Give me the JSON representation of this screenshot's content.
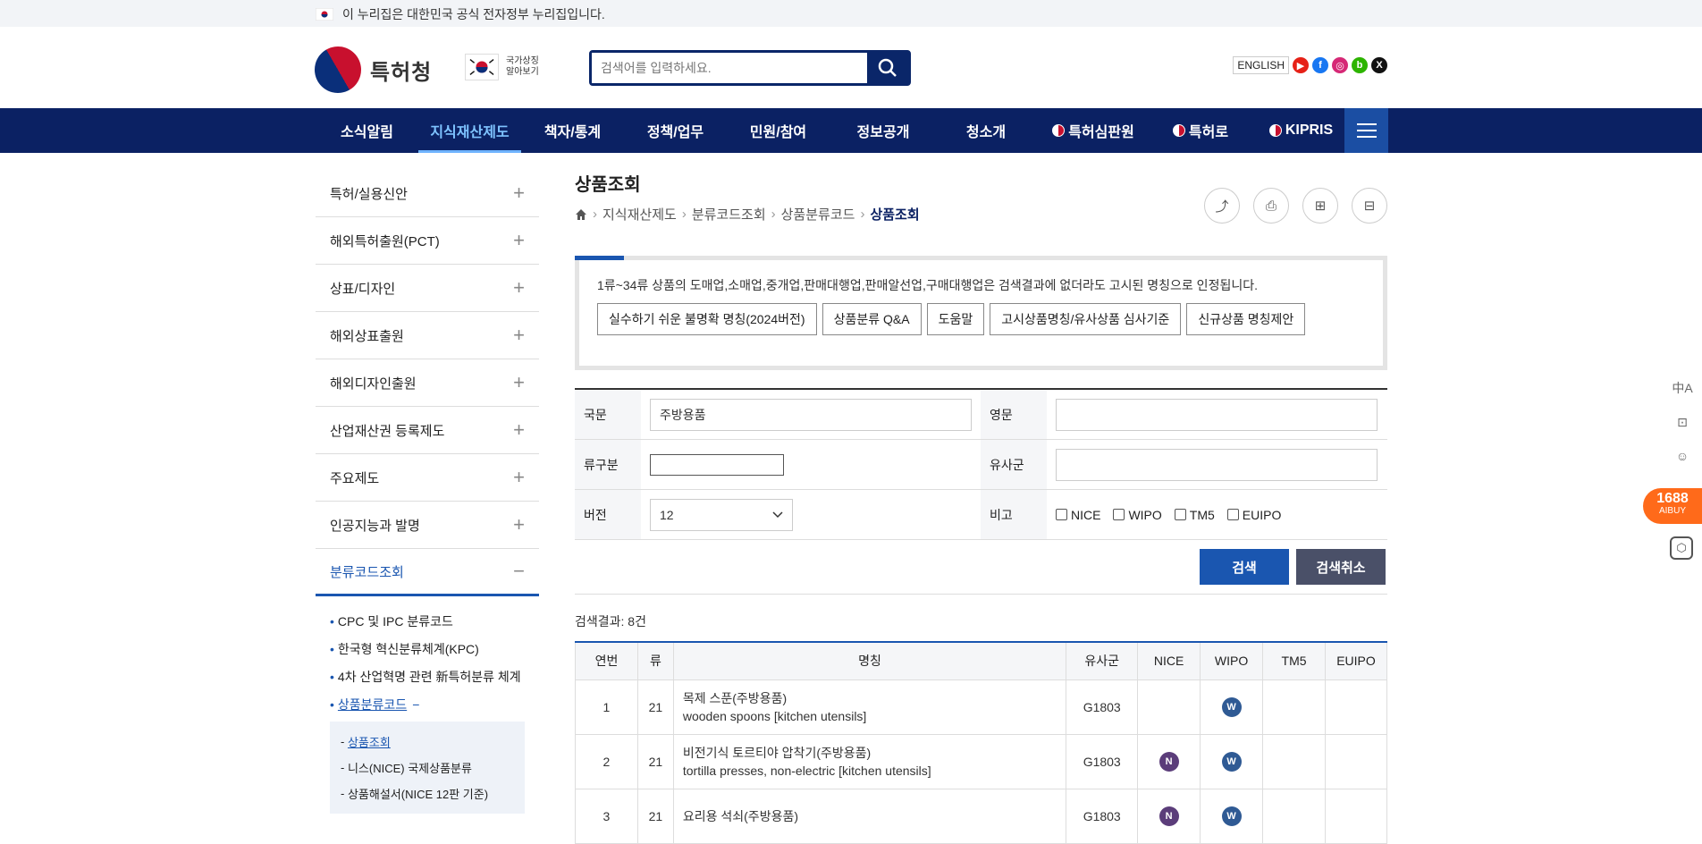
{
  "topbar": {
    "text": "이 누리집은 대한민국 공식 전자정부 누리집입니다."
  },
  "header": {
    "logo_text": "특허청",
    "symbol_line1": "국가상징",
    "symbol_line2": "알아보기",
    "search_placeholder": "검색어를 입력하세요.",
    "english": "ENGLISH",
    "sns": [
      {
        "icon": "youtube-icon",
        "glyph": "▶",
        "color": "#e62117"
      },
      {
        "icon": "facebook-icon",
        "glyph": "f",
        "color": "#1877f2"
      },
      {
        "icon": "instagram-icon",
        "glyph": "◎",
        "color": "#d62976"
      },
      {
        "icon": "blog-icon",
        "glyph": "b",
        "color": "#2db400"
      },
      {
        "icon": "x-icon",
        "glyph": "𝕏",
        "color": "#111111"
      }
    ]
  },
  "gnb": {
    "items": [
      "소식알림",
      "지식재산제도",
      "책자/통계",
      "정책/업무",
      "민원/참여",
      "정보공개",
      "청소개",
      "특허심판원",
      "특허로",
      "KIPRIS"
    ],
    "active_index": 1
  },
  "lnb": {
    "items": [
      "특허/실용신안",
      "해외특허출원(PCT)",
      "상표/디자인",
      "해외상표출원",
      "해외디자인출원",
      "산업재산권 등록제도",
      "주요제도",
      "인공지능과 발명",
      "분류코드조회"
    ],
    "sub": [
      "CPC 및 IPC 분류코드",
      "한국형 혁신분류체계(KPC)",
      "4차 산업혁명 관련 新특허분류 체계",
      "상품분류코드"
    ],
    "sub2": [
      "상품조회",
      "니스(NICE) 국제상품분류",
      "상품해설서(NICE 12판 기준)"
    ]
  },
  "page": {
    "title": "상품조회",
    "breadcrumb": [
      "지식재산제도",
      "분류코드조회",
      "상품분류코드",
      "상품조회"
    ]
  },
  "notice": {
    "text": "1류~34류 상품의 도매업,소매업,중개업,판매대행업,판매알선업,구매대행업은 검색결과에 없더라도 고시된 명칭으로 인정됩니다.",
    "buttons": [
      "실수하기 쉬운 불명확 명칭(2024버전)",
      "상품분류 Q&A",
      "도움말",
      "고시상품명칭/유사상품 심사기준",
      "신규상품 명칭제안"
    ]
  },
  "form": {
    "label_kor": "국문",
    "value_kor": "주방용품",
    "label_eng": "영문",
    "value_eng": "",
    "label_class": "류구분",
    "value_class": "",
    "label_similar": "유사군",
    "value_similar": "",
    "label_version": "버전",
    "value_version": "12",
    "label_note": "비고",
    "checkboxes": [
      "NICE",
      "WIPO",
      "TM5",
      "EUIPO"
    ],
    "search_btn": "검색",
    "cancel_btn": "검색취소",
    "search_color": "#1a56b0",
    "cancel_color": "#4a5068"
  },
  "results": {
    "count": "검색결과: 8건",
    "headers": [
      "연번",
      "류",
      "명칭",
      "유사군",
      "NICE",
      "WIPO",
      "TM5",
      "EUIPO"
    ],
    "rows": [
      {
        "no": "1",
        "cls": "21",
        "kor": "목제 스푼(주방용품)",
        "eng": "wooden spoons [kitchen utensils]",
        "sim": "G1803",
        "nice": "",
        "wipo": "W"
      },
      {
        "no": "2",
        "cls": "21",
        "kor": "비전기식 토르티야 압착기(주방용품)",
        "eng": "tortilla presses, non-electric [kitchen utensils]",
        "sim": "G1803",
        "nice": "N",
        "wipo": "W"
      },
      {
        "no": "3",
        "cls": "21",
        "kor": "요리용 석쇠(주방용품)",
        "eng": "",
        "sim": "G1803",
        "nice": "N",
        "wipo": "W"
      }
    ],
    "nice_color": "#5b3d7a",
    "wipo_color": "#2f5a94"
  },
  "float": {
    "aibuy_top": "1688",
    "aibuy_bottom": "AIBUY"
  }
}
